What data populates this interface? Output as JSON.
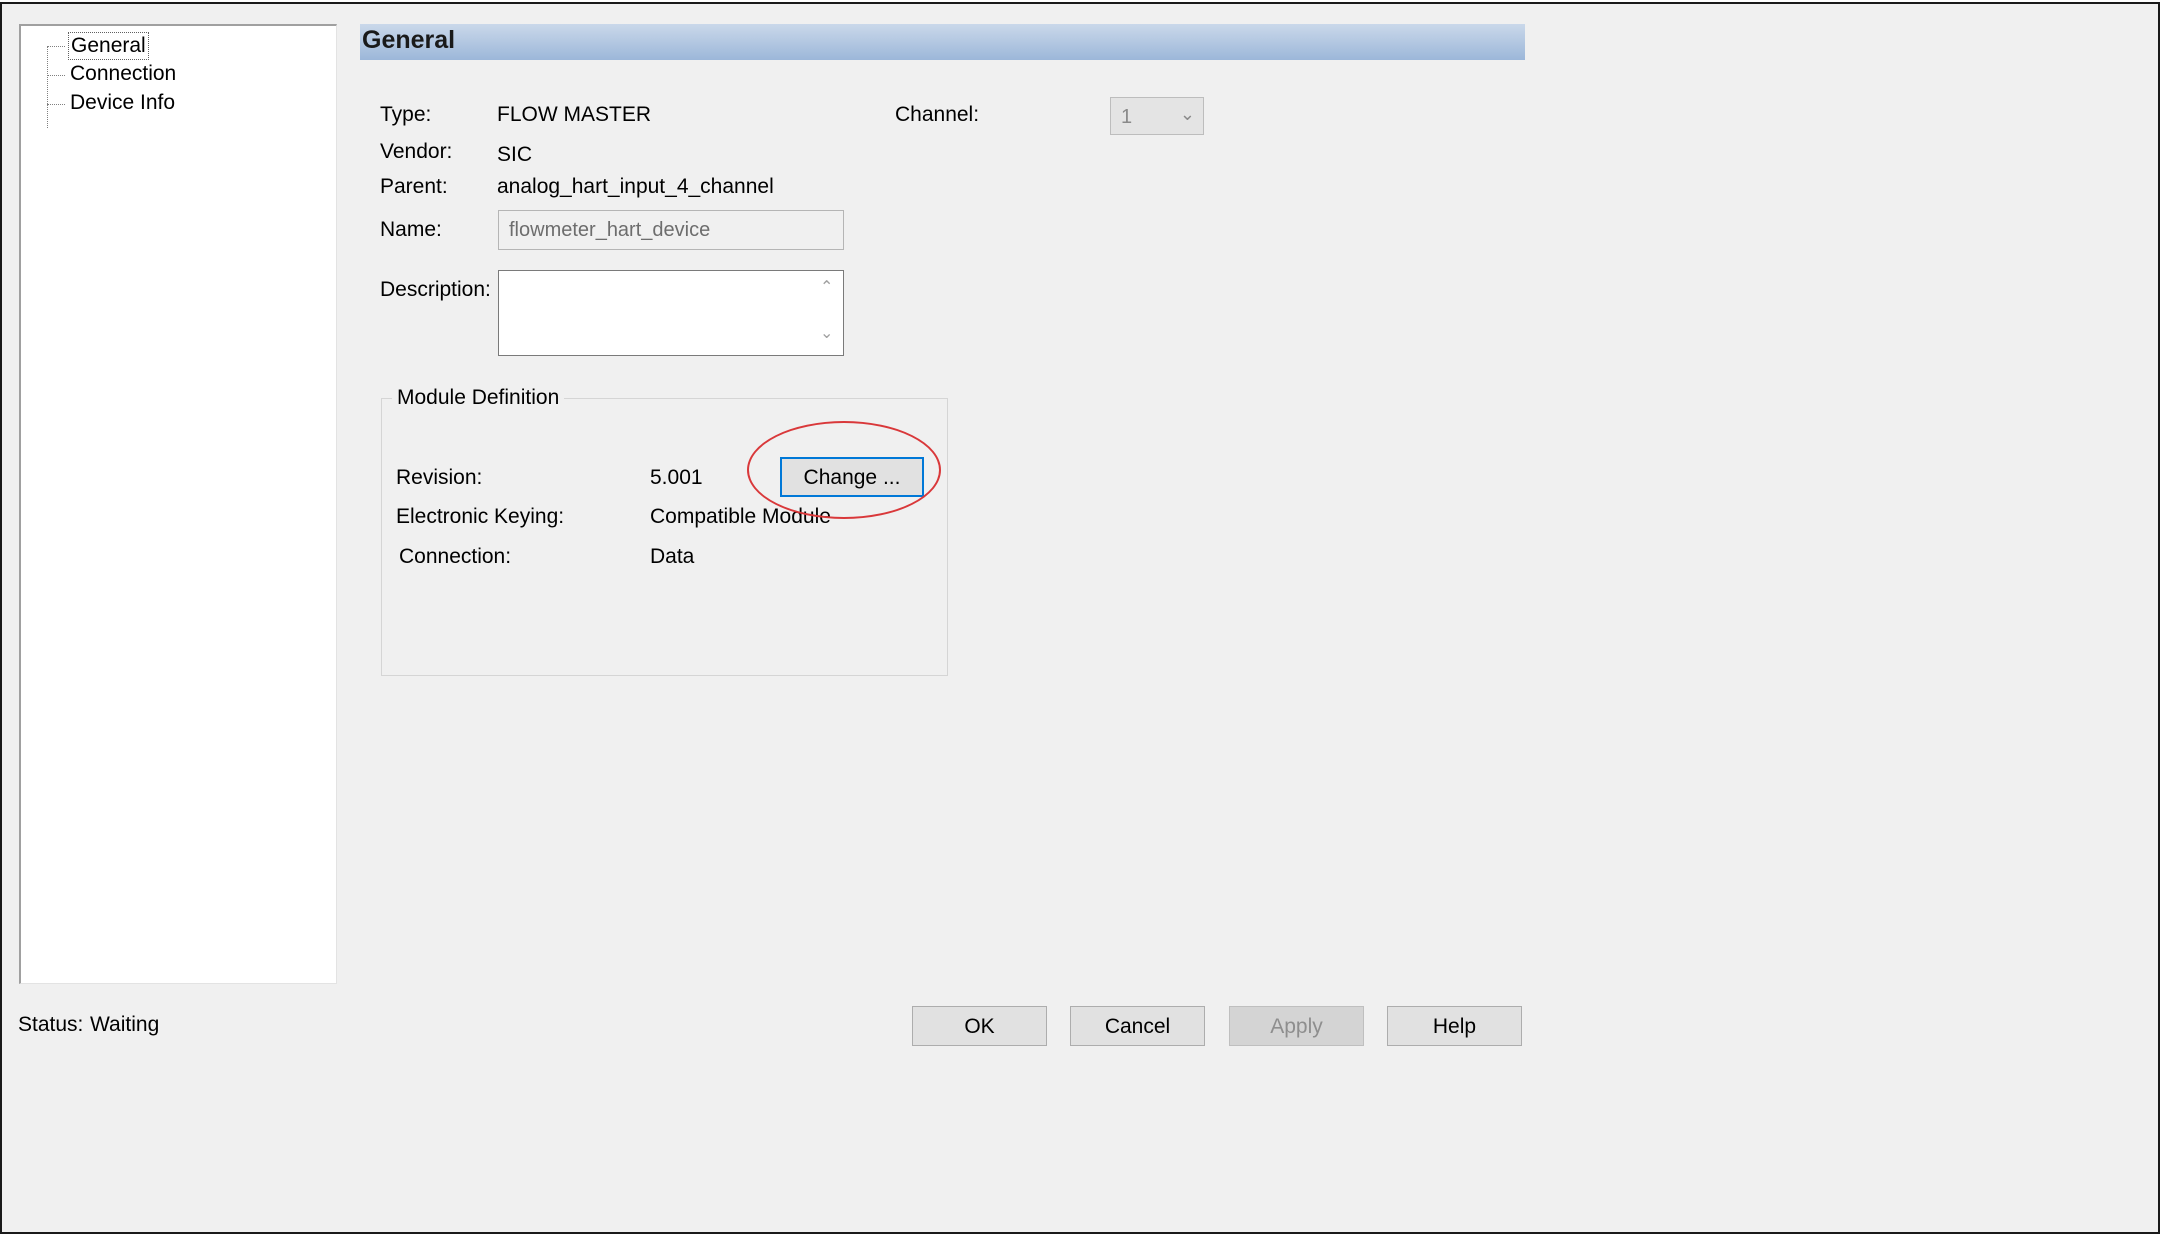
{
  "tree": {
    "items": [
      {
        "label": "General",
        "selected": true
      },
      {
        "label": "Connection",
        "selected": false
      },
      {
        "label": "Device Info",
        "selected": false
      }
    ]
  },
  "header": {
    "title": "General"
  },
  "fields": {
    "type_label": "Type:",
    "type_value": "FLOW MASTER",
    "vendor_label": "Vendor:",
    "vendor_value": "SIC",
    "parent_label": "Parent:",
    "parent_value": "analog_hart_input_4_channel",
    "name_label": "Name:",
    "name_value": "flowmeter_hart_device",
    "description_label": "Description:",
    "description_value": "",
    "channel_label": "Channel:",
    "channel_value": "1"
  },
  "module_definition": {
    "title": "Module Definition",
    "revision_label": "Revision:",
    "revision_value": "5.001",
    "change_button": "Change ...",
    "keying_label": "Electronic Keying:",
    "keying_value": "Compatible Module",
    "connection_label": "Connection:",
    "connection_value": "Data"
  },
  "status": {
    "label": "Status:",
    "value": "Waiting"
  },
  "buttons": {
    "ok": "OK",
    "cancel": "Cancel",
    "apply": "Apply",
    "help": "Help"
  },
  "colors": {
    "highlight_circle": "#d9383a",
    "focus_border": "#0078d7",
    "banner": "#9cb7d9"
  }
}
